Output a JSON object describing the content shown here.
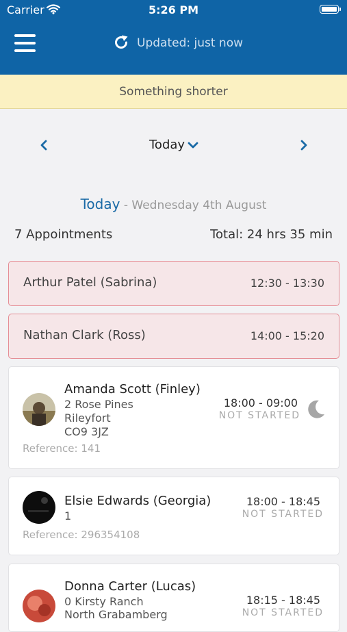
{
  "status_bar": {
    "carrier": "Carrier",
    "time": "5:26 PM"
  },
  "header": {
    "updated": "Updated: just now"
  },
  "banner": {
    "text": "Something shorter"
  },
  "nav": {
    "day": "Today"
  },
  "date": {
    "today": "Today",
    "full": " - Wednesday 4th August"
  },
  "summary": {
    "count": "7 Appointments",
    "total": "Total: 24 hrs 35 min"
  },
  "alerts": [
    {
      "name": "Arthur Patel (Sabrina)",
      "time": "12:30 - 13:30"
    },
    {
      "name": "Nathan Clark (Ross)",
      "time": "14:00 - 15:20"
    }
  ],
  "appointments": [
    {
      "name": "Amanda Scott (Finley)",
      "address": [
        "2 Rose Pines",
        "Rileyfort",
        "CO9 3JZ"
      ],
      "reference": "Reference: 141",
      "time": "18:00 - 09:00",
      "status": "NOT STARTED",
      "icon": "moon-icon"
    },
    {
      "name": "Elsie Edwards (Georgia)",
      "address": [
        "1"
      ],
      "reference": "Reference: 296354108",
      "time": "18:00 - 18:45",
      "status": "NOT STARTED"
    },
    {
      "name": "Donna Carter (Lucas)",
      "address": [
        "0 Kirsty Ranch",
        "North Grabamberg"
      ],
      "time": "18:15 - 18:45",
      "status": "NOT STARTED"
    }
  ],
  "colors": {
    "header": "#0f64a6",
    "banner": "#fbf1c2",
    "alert_bg": "#f6e6e8",
    "alert_border": "#e58d95",
    "link": "#1a6aa6"
  }
}
